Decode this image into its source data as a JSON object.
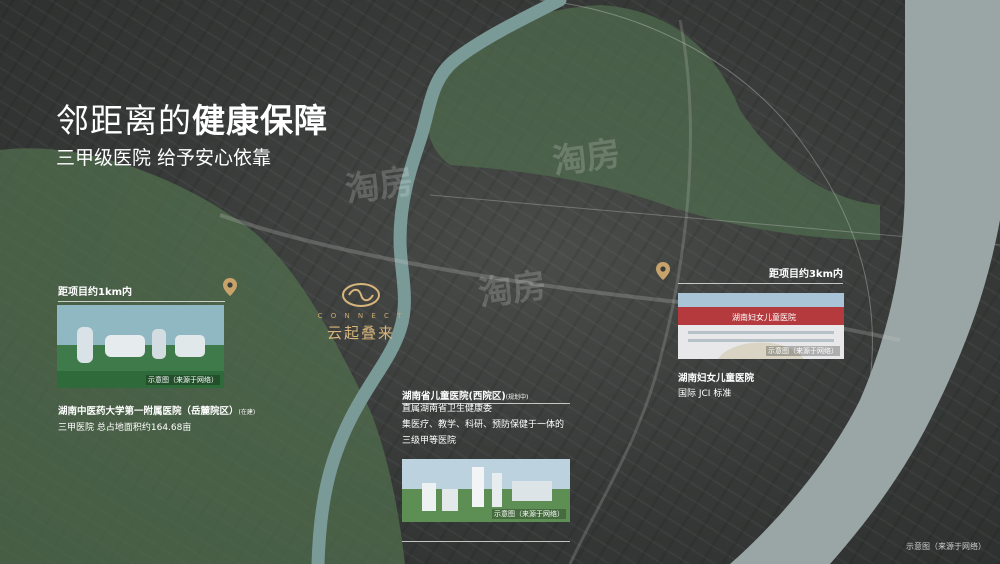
{
  "heading": {
    "light": "邻距离的",
    "bold": "健康保障",
    "subtitle": "三甲级医院 给予安心依靠"
  },
  "watermarks": [
    "淘房",
    "淘房",
    "淘房"
  ],
  "brand": {
    "en": "C O N N E C T",
    "cn": "云起叠来"
  },
  "hospitals": [
    {
      "distance": "距项目约1km内",
      "name": "湖南中医药大学第一附属医院（岳麓院区）",
      "name_note": "(在建)",
      "desc": [
        "三甲医院 总占地面积约164.68亩"
      ],
      "caption": "示意图（来源于网络）"
    },
    {
      "distance": "距项目约3km内",
      "name": "湖南妇女儿童医院",
      "sign": "湖南妇女儿童医院",
      "desc": [
        "国际 JCI 标准"
      ],
      "caption": "示意图（来源于网络）"
    },
    {
      "name": "湖南省儿童医院(西院区)",
      "name_note": "(规划中)",
      "desc": [
        "直属湖南省卫生健康委",
        "集医疗、教学、科研、预防保健于一体的",
        "三级甲等医院"
      ],
      "caption": "示意图（来源于网络）"
    }
  ],
  "footnote": "示意图（来源于网络）",
  "colors": {
    "green_zone": "#4f6b4e",
    "river": "#7a9a98",
    "yangtze": "#9aa6a5",
    "gold": "#d8b57a"
  }
}
